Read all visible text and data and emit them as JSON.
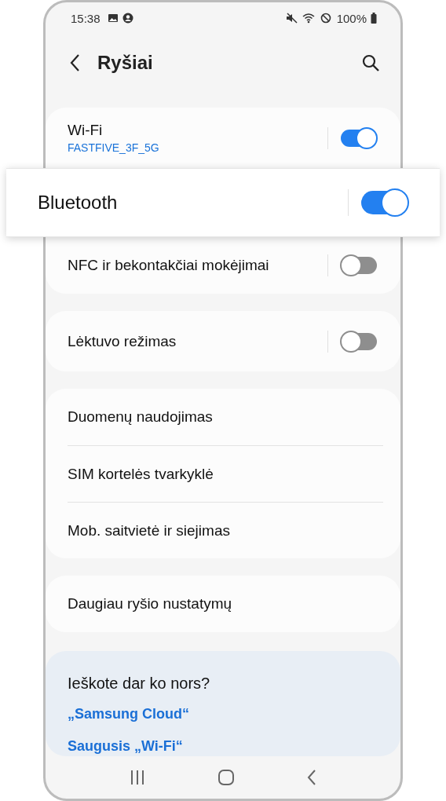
{
  "status_bar": {
    "time": "15:38",
    "battery": "100%"
  },
  "header": {
    "title": "Ryšiai"
  },
  "groups": [
    {
      "items": [
        {
          "kind": "toggle",
          "label": "Wi-Fi",
          "subtitle": "FASTFIVE_3F_5G",
          "on": true,
          "highlighted": false
        },
        {
          "kind": "toggle",
          "label": "Bluetooth",
          "on": true,
          "highlighted": true
        },
        {
          "kind": "toggle",
          "label": "NFC ir bekontakčiai mokėjimai",
          "on": false,
          "highlighted": false
        }
      ]
    },
    {
      "items": [
        {
          "kind": "toggle",
          "label": "Lėktuvo režimas",
          "on": false,
          "highlighted": false
        }
      ]
    },
    {
      "items": [
        {
          "kind": "link",
          "label": "Duomenų naudojimas"
        },
        {
          "kind": "link",
          "label": "SIM kortelės tvarkyklė"
        },
        {
          "kind": "link",
          "label": "Mob. saitvietė ir siejimas"
        }
      ]
    },
    {
      "items": [
        {
          "kind": "link",
          "label": "Daugiau ryšio nustatymų"
        }
      ]
    }
  ],
  "suggestions": {
    "title": "Ieškote dar ko nors?",
    "links": [
      "„Samsung Cloud“",
      "Saugusis „Wi-Fi“"
    ]
  }
}
